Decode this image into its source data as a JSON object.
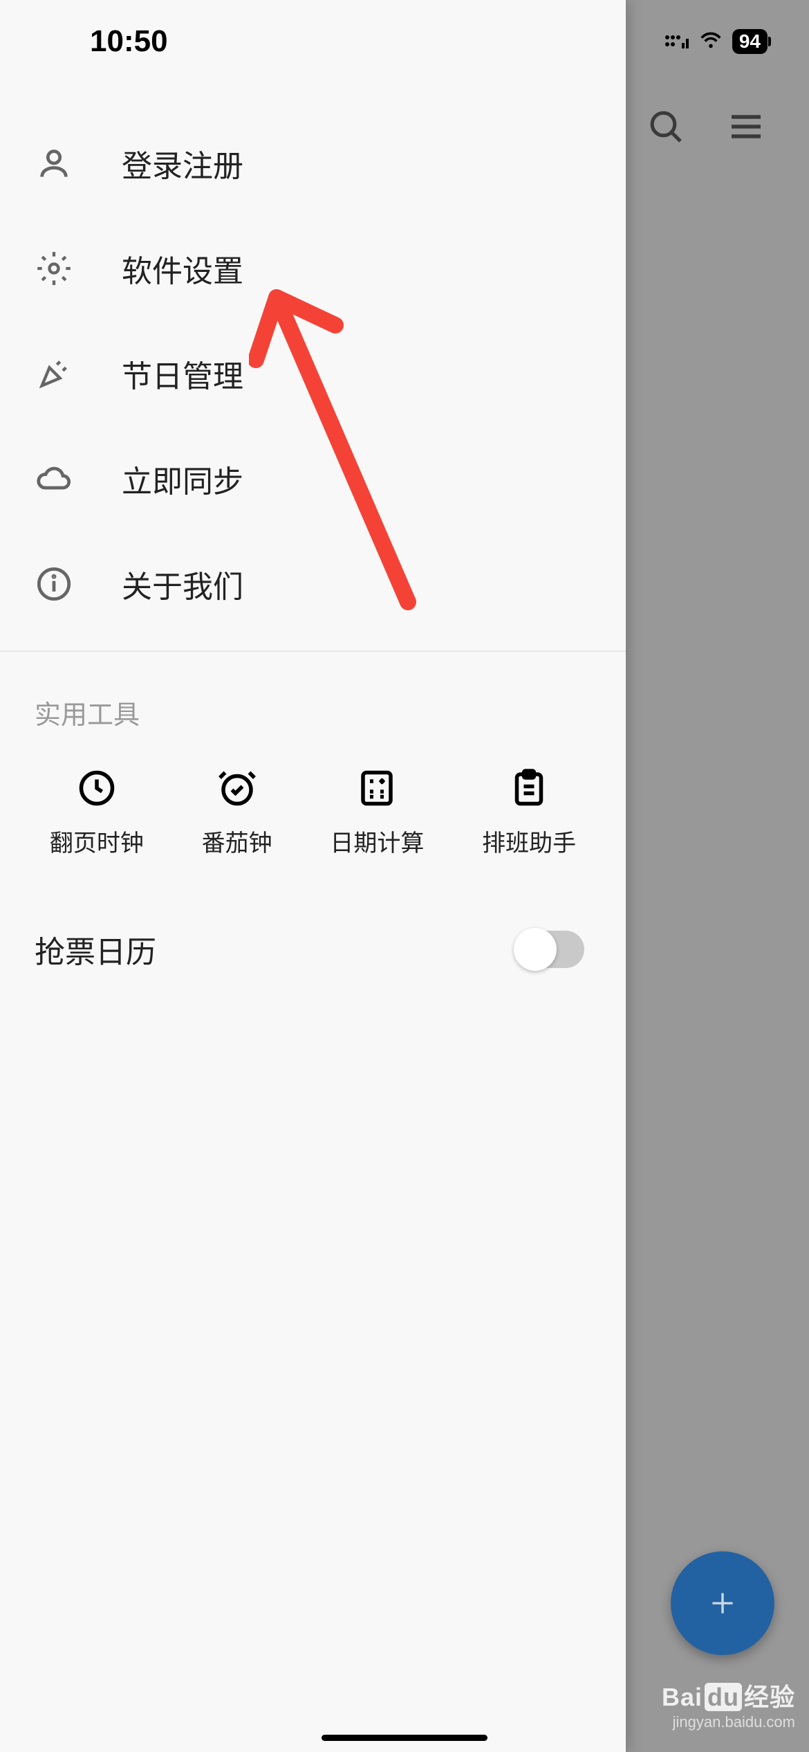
{
  "status": {
    "time": "10:50",
    "battery": "94"
  },
  "drawer": {
    "menu": [
      {
        "id": "login",
        "label": "登录注册"
      },
      {
        "id": "settings",
        "label": "软件设置"
      },
      {
        "id": "holidays",
        "label": "节日管理"
      },
      {
        "id": "sync",
        "label": "立即同步"
      },
      {
        "id": "about",
        "label": "关于我们"
      }
    ],
    "tools_section": "实用工具",
    "tools": [
      {
        "id": "flip-clock",
        "label": "翻页时钟"
      },
      {
        "id": "pomodoro",
        "label": "番茄钟"
      },
      {
        "id": "date-calc",
        "label": "日期计算"
      },
      {
        "id": "shift",
        "label": "排班助手"
      }
    ],
    "ticket_toggle": {
      "label": "抢票日历",
      "on": false
    }
  },
  "watermark": {
    "brand": "Bai",
    "brand2": "du",
    "brand3": "经验",
    "url": "jingyan.baidu.com"
  }
}
